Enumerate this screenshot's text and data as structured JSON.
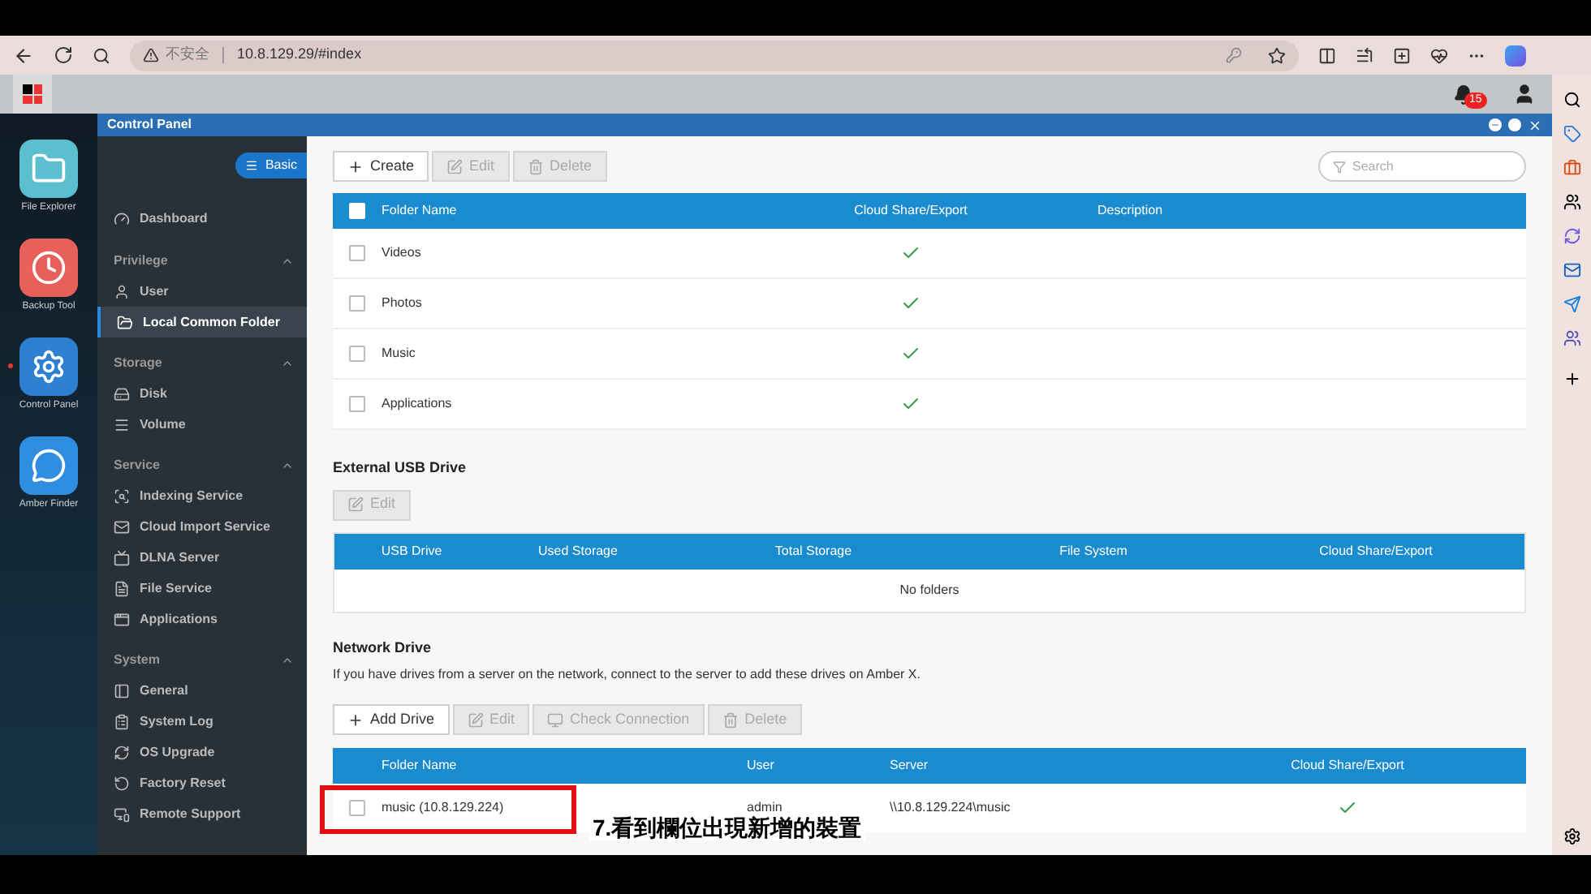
{
  "browser": {
    "security_label": "不安全",
    "url": "10.8.129.29/#index"
  },
  "app_bar": {
    "notification_count": "15"
  },
  "window": {
    "title": "Control Panel"
  },
  "dock": [
    {
      "label": "File Explorer",
      "running": false
    },
    {
      "label": "Backup Tool",
      "running": false
    },
    {
      "label": "Control Panel",
      "running": true
    },
    {
      "label": "Amber Finder",
      "running": false
    }
  ],
  "nav": {
    "mode_button": "Basic",
    "items": [
      {
        "kind": "item",
        "label": "Dashboard",
        "selected": false
      },
      {
        "kind": "group",
        "label": "Privilege",
        "expanded": true,
        "children": [
          {
            "label": "User",
            "selected": false
          },
          {
            "label": "Local Common Folder",
            "selected": true
          }
        ]
      },
      {
        "kind": "group",
        "label": "Storage",
        "expanded": true,
        "children": [
          {
            "label": "Disk",
            "selected": false
          },
          {
            "label": "Volume",
            "selected": false
          }
        ]
      },
      {
        "kind": "group",
        "label": "Service",
        "expanded": true,
        "children": [
          {
            "label": "Indexing Service",
            "selected": false
          },
          {
            "label": "Cloud Import Service",
            "selected": false
          },
          {
            "label": "DLNA Server",
            "selected": false
          },
          {
            "label": "File Service",
            "selected": false
          },
          {
            "label": "Applications",
            "selected": false
          }
        ]
      },
      {
        "kind": "group",
        "label": "System",
        "expanded": true,
        "children": [
          {
            "label": "General",
            "selected": false
          },
          {
            "label": "System Log",
            "selected": false
          },
          {
            "label": "OS Upgrade",
            "selected": false
          },
          {
            "label": "Factory Reset",
            "selected": false
          },
          {
            "label": "Remote Support",
            "selected": false
          }
        ]
      }
    ]
  },
  "toolbar": [
    {
      "kind": "create",
      "label": "Create",
      "disabled": false
    },
    {
      "kind": "edit",
      "label": "Edit",
      "disabled": true
    },
    {
      "kind": "delete",
      "label": "Delete",
      "disabled": true
    }
  ],
  "search": {
    "placeholder": "Search"
  },
  "folders": {
    "select_all_checked": false,
    "columns": [
      "Folder Name",
      "Cloud Share/Export",
      "Description"
    ],
    "rows": [
      {
        "name": "Videos",
        "checked": false,
        "cloud_share": true
      },
      {
        "name": "Photos",
        "checked": false,
        "cloud_share": true
      },
      {
        "name": "Music",
        "checked": false,
        "cloud_share": true
      },
      {
        "name": "Applications",
        "checked": false,
        "cloud_share": true
      }
    ]
  },
  "usb": {
    "title": "External USB Drive",
    "buttons": [
      {
        "kind": "edit",
        "label": "Edit",
        "disabled": true
      }
    ],
    "columns": [
      "USB Drive",
      "Used Storage",
      "Total Storage",
      "File System",
      "Cloud Share/Export"
    ],
    "empty_text": "No folders"
  },
  "network": {
    "title": "Network Drive",
    "description": "If you have drives from a server on the network, connect to the server to add these drives on Amber X.",
    "buttons": [
      {
        "kind": "create",
        "label": "Add Drive",
        "disabled": false
      },
      {
        "kind": "edit",
        "label": "Edit",
        "disabled": true
      },
      {
        "kind": "connection",
        "label": "Check Connection",
        "disabled": true
      },
      {
        "kind": "delete",
        "label": "Delete",
        "disabled": true
      }
    ],
    "columns": [
      "Folder Name",
      "User",
      "Server",
      "Cloud Share/Export"
    ],
    "rows": [
      {
        "name": "music (10.8.129.224)",
        "user": "admin",
        "server": "\\\\10.8.129.224\\music",
        "checked": false,
        "cloud_share": true,
        "highlighted": true
      }
    ]
  },
  "caption": "7.看到欄位出現新增的裝置"
}
